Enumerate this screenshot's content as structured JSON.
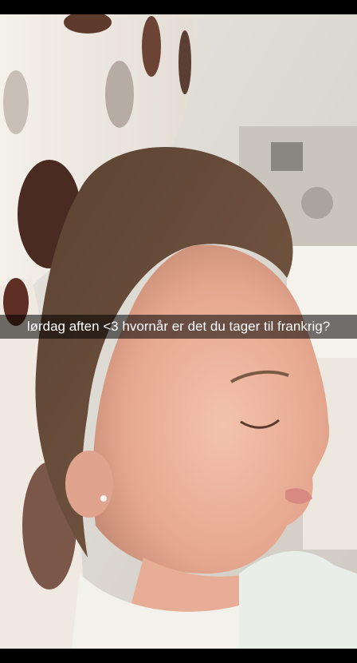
{
  "caption": {
    "text": "lørdag aften <3 hvornår er det du tager til frankrig?"
  },
  "photo": {
    "subject_icon": "sleeping-person-photo"
  },
  "colors": {
    "frame": "#000000",
    "caption_background": "#00000088",
    "caption_text": "#ffffff"
  }
}
